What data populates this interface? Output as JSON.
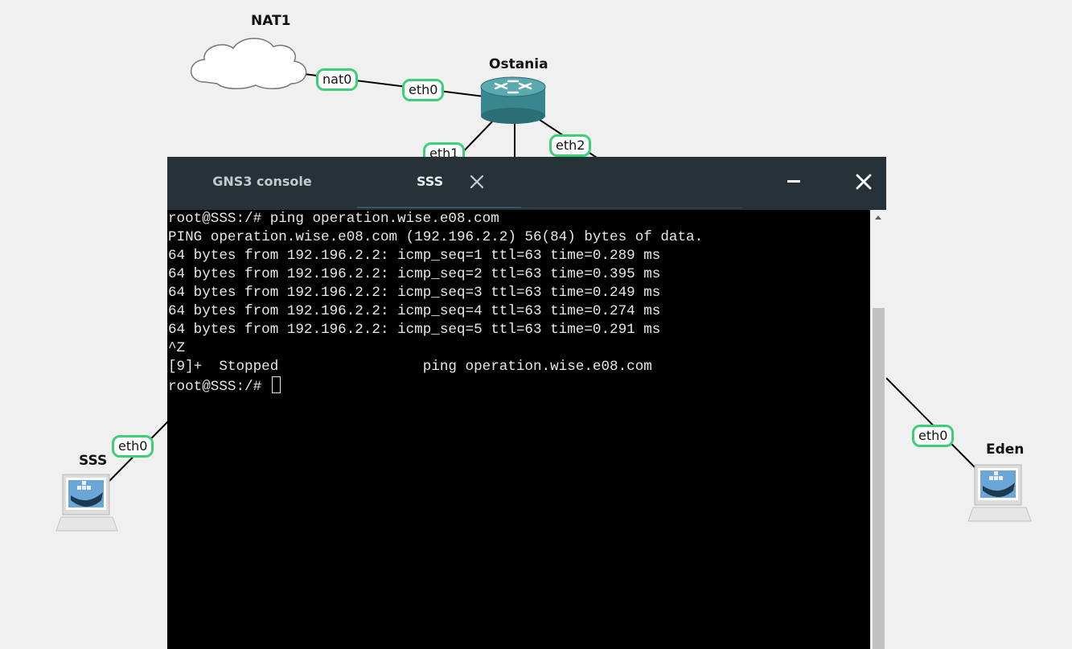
{
  "topology": {
    "nodes": [
      {
        "id": "nat1",
        "label": "NAT1",
        "icon": "cloud-icon"
      },
      {
        "id": "ostania",
        "label": "Ostania",
        "icon": "router-icon"
      },
      {
        "id": "sss",
        "label": "SSS",
        "icon": "docker-host-icon"
      },
      {
        "id": "eden",
        "label": "Eden",
        "icon": "docker-host-icon"
      }
    ],
    "ports": {
      "nat1_nat0": "nat0",
      "ostania_eth0": "eth0",
      "ostania_eth1": "eth1",
      "ostania_eth2": "eth2",
      "sss_eth0": "eth0",
      "eden_eth0": "eth0"
    },
    "link_color": "#000000",
    "port_border_color": "#3ccf78"
  },
  "console": {
    "tabs": [
      {
        "label": "GNS3 console",
        "active": false
      },
      {
        "label": "SSS",
        "active": true
      }
    ],
    "header_color": "#263238",
    "buttons": {
      "minimize": "minimize-icon",
      "close": "close-icon"
    },
    "terminal_lines": [
      "root@SSS:/# ping operation.wise.e08.com",
      "PING operation.wise.e08.com (192.196.2.2) 56(84) bytes of data.",
      "64 bytes from 192.196.2.2: icmp_seq=1 ttl=63 time=0.289 ms",
      "64 bytes from 192.196.2.2: icmp_seq=2 ttl=63 time=0.395 ms",
      "64 bytes from 192.196.2.2: icmp_seq=3 ttl=63 time=0.249 ms",
      "64 bytes from 192.196.2.2: icmp_seq=4 ttl=63 time=0.274 ms",
      "64 bytes from 192.196.2.2: icmp_seq=5 ttl=63 time=0.291 ms",
      "^Z",
      "[9]+  Stopped                 ping operation.wise.e08.com"
    ],
    "prompt": "root@SSS:/# "
  }
}
